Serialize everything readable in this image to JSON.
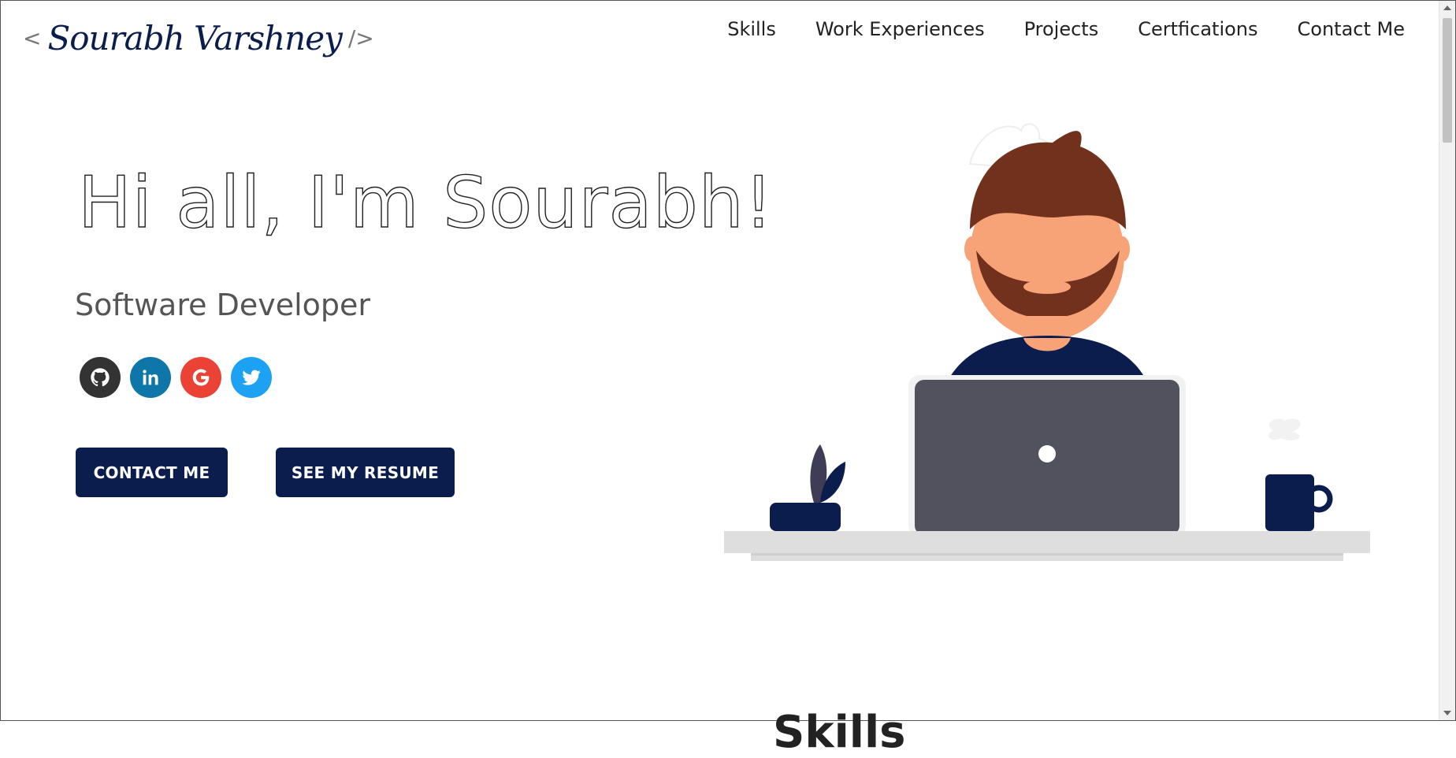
{
  "header": {
    "logo_open": "<",
    "logo_name": "Sourabh Varshney",
    "logo_close": "/>",
    "nav": [
      "Skills",
      "Work Experiences",
      "Projects",
      "Certfications",
      "Contact Me"
    ]
  },
  "hero": {
    "greeting": "Hi all, I'm Sourabh!",
    "subtitle": "Software Developer",
    "socials": [
      {
        "name": "github-icon",
        "color": "#333333"
      },
      {
        "name": "linkedin-icon",
        "color": "#0e76a8"
      },
      {
        "name": "google-icon",
        "color": "#ea4335"
      },
      {
        "name": "twitter-icon",
        "color": "#1da1f2"
      }
    ],
    "contact_button": "CONTACT ME",
    "resume_button": "SEE MY RESUME"
  },
  "colors": {
    "accent": "#0a1d4d",
    "text": "#222222",
    "muted": "#555555"
  },
  "next_section": {
    "title": "Skills"
  }
}
